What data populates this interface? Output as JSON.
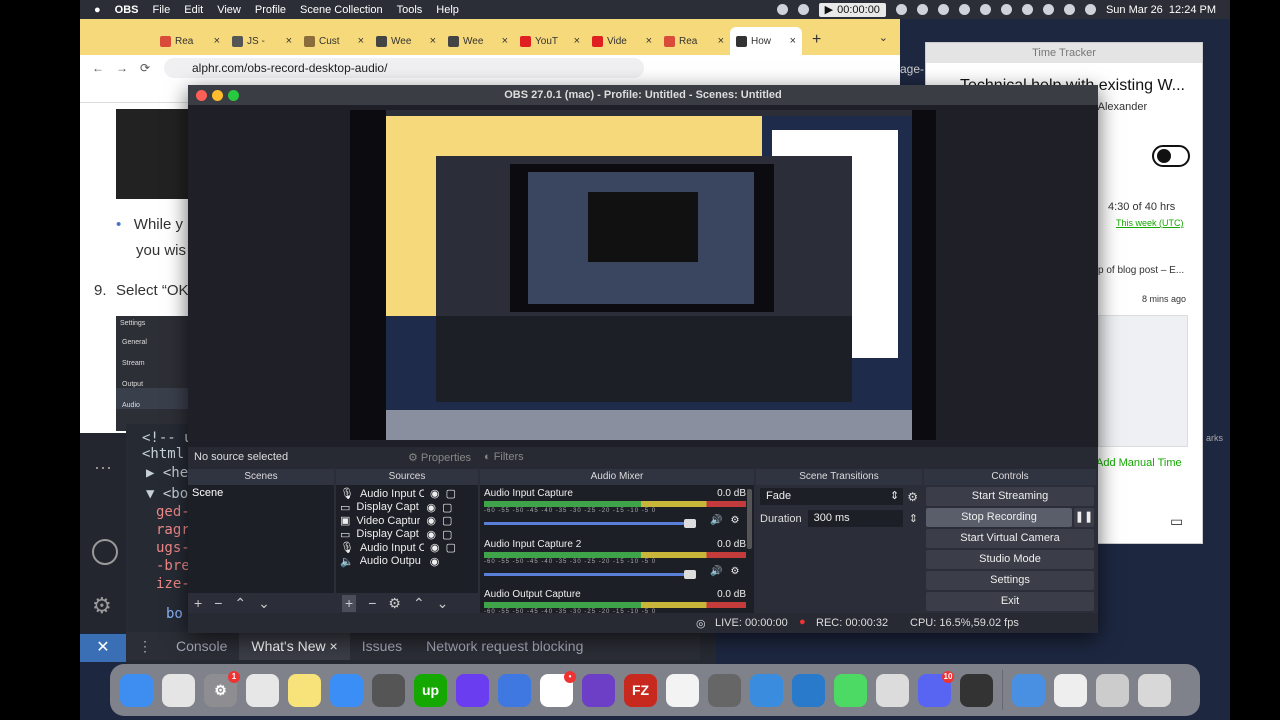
{
  "menubar": {
    "app": "OBS",
    "items": [
      "File",
      "Edit",
      "View",
      "Profile",
      "Scene Collection",
      "Tools",
      "Help"
    ],
    "timer": "00:00:00",
    "datetime": "Sun Mar 26  12:24 PM"
  },
  "browser": {
    "tabs": [
      {
        "label": "Rea",
        "color": "#d94c3a"
      },
      {
        "label": "JS -",
        "color": "#555"
      },
      {
        "label": "Cust",
        "color": "#8a6d3b"
      },
      {
        "label": "Wee",
        "color": "#444"
      },
      {
        "label": "Wee",
        "color": "#444"
      },
      {
        "label": "YouT",
        "color": "#e02020"
      },
      {
        "label": "Vide",
        "color": "#e02020"
      },
      {
        "label": "Rea",
        "color": "#d94c3a"
      },
      {
        "label": "How",
        "color": "#333"
      }
    ],
    "url": "alphr.com/obs-record-desktop-audio/",
    "page": {
      "bullet_text_1": "While y",
      "bullet_text_2": "you wis",
      "step_number": "9.",
      "step_text": "Select “OK",
      "settings_title": "Settings",
      "settings_items": [
        "General",
        "Stream",
        "Output",
        "Audio"
      ]
    }
  },
  "devtools": {
    "lines": [
      "<!-- u",
      "<html",
      "▶ <hea",
      "▼ <bod",
      "ged-",
      "ragr",
      "ugs-",
      "-bre",
      "ize-",
      "bo"
    ],
    "tabs": [
      "Console",
      "What's New",
      "Issues",
      "Network request blocking"
    ],
    "side_text": "age-"
  },
  "tracker": {
    "header": "Time Tracker",
    "title": "Technical help with existing W...",
    "person": "nt Alexander",
    "hours": "4:30 of 40 hrs",
    "period": "This week (UTC)",
    "task": "p of blog post – E...",
    "ago": "8 mins ago",
    "add_manual": "Add Manual Time",
    "side_text": "arks"
  },
  "obs": {
    "title": "OBS 27.0.1 (mac) - Profile: Untitled - Scenes: Untitled",
    "no_source": "No source selected",
    "properties": "Properties",
    "filters": "Filters",
    "docks": {
      "scenes": "Scenes",
      "sources": "Sources",
      "mixer": "Audio Mixer",
      "transitions": "Scene Transitions",
      "controls": "Controls"
    },
    "scenes": [
      "Scene"
    ],
    "sources": [
      "Audio Input C",
      "Display Capt",
      "Video Captur",
      "Display Capt",
      "Audio Input C",
      "Audio Outpu"
    ],
    "mixer": [
      {
        "name": "Audio Input Capture",
        "db": "0.0 dB"
      },
      {
        "name": "Audio Input Capture 2",
        "db": "0.0 dB"
      },
      {
        "name": "Audio Output Capture",
        "db": "0.0 dB"
      }
    ],
    "meter_ticks": "-60 -55 -50 -45 -40 -35 -30 -25 -20 -15 -10 -5 0",
    "transition": "Fade",
    "duration_label": "Duration",
    "duration_value": "300 ms",
    "controls": [
      "Start Streaming",
      "Stop Recording",
      "Start Virtual Camera",
      "Studio Mode",
      "Settings",
      "Exit"
    ],
    "status": {
      "live": "LIVE: 00:00:00",
      "rec": "REC: 00:00:32",
      "cpu": "CPU: 16.5%,59.02 fps"
    }
  },
  "dock": {
    "apps": [
      {
        "name": "Finder",
        "color": "#3d8ef0",
        "glyph": ""
      },
      {
        "name": "Launchpad",
        "color": "#e5e5e5",
        "glyph": ""
      },
      {
        "name": "System Preferences",
        "color": "#8d8d92",
        "glyph": "⚙",
        "badge": "1"
      },
      {
        "name": "Chrome",
        "color": "#e7e7e7",
        "glyph": ""
      },
      {
        "name": "Notes",
        "color": "#f8e27a",
        "glyph": ""
      },
      {
        "name": "Safari",
        "color": "#3a8ef5",
        "glyph": ""
      },
      {
        "name": "Calculator",
        "color": "#555",
        "glyph": ""
      },
      {
        "name": "Upwork",
        "color": "#14a800",
        "glyph": "up"
      },
      {
        "name": "Pen",
        "color": "#6b3df0",
        "glyph": ""
      },
      {
        "name": "App",
        "color": "#3e78e0",
        "glyph": ""
      },
      {
        "name": "Slack",
        "color": "#fff",
        "glyph": "✱",
        "badge": "•"
      },
      {
        "name": "GitHub",
        "color": "#6d3fc7",
        "glyph": ""
      },
      {
        "name": "FileZilla",
        "color": "#c8291e",
        "glyph": "FZ"
      },
      {
        "name": "Pen tool",
        "color": "#f3f3f3",
        "glyph": ""
      },
      {
        "name": "GIMP",
        "color": "#666",
        "glyph": ""
      },
      {
        "name": "Xcode",
        "color": "#3a8dde",
        "glyph": ""
      },
      {
        "name": "VS Code",
        "color": "#2a7acb",
        "glyph": ""
      },
      {
        "name": "Messages",
        "color": "#4cd964",
        "glyph": ""
      },
      {
        "name": "Preview",
        "color": "#dcdcdc",
        "glyph": ""
      },
      {
        "name": "Discord",
        "color": "#5865f2",
        "glyph": "",
        "badge": "10"
      },
      {
        "name": "OBS",
        "color": "#333",
        "glyph": ""
      },
      {
        "name": "Downloads",
        "color": "#4a90e2",
        "glyph": ""
      },
      {
        "name": "Screenshot",
        "color": "#eee",
        "glyph": ""
      },
      {
        "name": "Printer",
        "color": "#ccc",
        "glyph": ""
      },
      {
        "name": "Trash",
        "color": "#d8d8d8",
        "glyph": ""
      }
    ]
  }
}
